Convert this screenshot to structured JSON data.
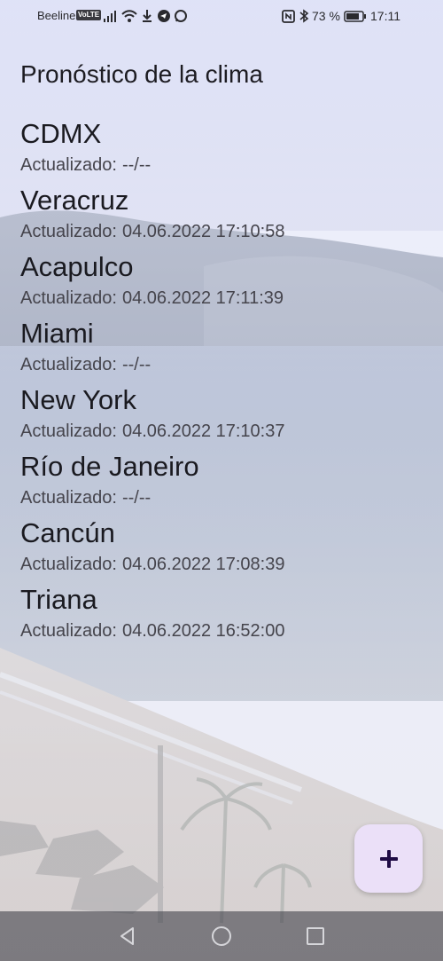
{
  "status_bar": {
    "carrier": "Beeline",
    "volte": "VoLTE",
    "battery_percent": "73 %",
    "time": "17:11",
    "icons": [
      "signal-icon",
      "wifi-icon",
      "download-icon",
      "telegram-icon",
      "whatsapp-icon",
      "nfc-icon",
      "bluetooth-icon",
      "battery-icon"
    ]
  },
  "app": {
    "title": "Pronóstico de la clima",
    "updated_label": "Actualizado:",
    "cities": [
      {
        "name": "CDMX",
        "updated": "--/--"
      },
      {
        "name": "Veracruz",
        "updated": "04.06.2022 17:10:58"
      },
      {
        "name": "Acapulco",
        "updated": "04.06.2022 17:11:39"
      },
      {
        "name": "Miami",
        "updated": "--/--"
      },
      {
        "name": "New York",
        "updated": "04.06.2022 17:10:37"
      },
      {
        "name": "Río de Janeiro",
        "updated": "--/--"
      },
      {
        "name": "Cancún",
        "updated": "04.06.2022 17:08:39"
      },
      {
        "name": "Triana",
        "updated": "04.06.2022 16:52:00"
      }
    ]
  },
  "fab": {
    "icon": "plus-icon",
    "color": "#ebe0f8",
    "icon_color": "#1f0b45"
  },
  "nav_bar": {
    "buttons": [
      "back-icon",
      "home-icon",
      "recents-icon"
    ]
  }
}
